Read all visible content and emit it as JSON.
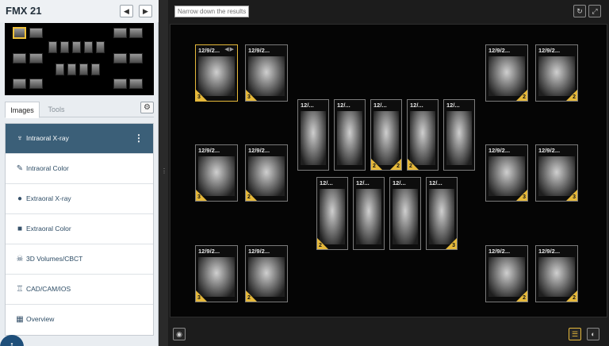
{
  "header": {
    "title": "FMX 21",
    "prev_icon": "triangle-left-icon",
    "next_icon": "triangle-right-icon"
  },
  "tabs": [
    {
      "label": "Images",
      "active": true
    },
    {
      "label": "Tools",
      "active": false
    }
  ],
  "menu": [
    {
      "label": "Intraoral X-ray",
      "icon": "tooth-icon",
      "active": true
    },
    {
      "label": "Intraoral Color",
      "icon": "tool-icon",
      "active": false
    },
    {
      "label": "Extraoral X-ray",
      "icon": "head-icon",
      "active": false
    },
    {
      "label": "Extraoral Color",
      "icon": "camera-icon",
      "active": false
    },
    {
      "label": "3D Volumes/CBCT",
      "icon": "skull-icon",
      "active": false
    },
    {
      "label": "CAD/CAM/IOS",
      "icon": "crown-icon",
      "active": false
    },
    {
      "label": "Overview",
      "icon": "grid-icon",
      "active": false
    }
  ],
  "filter": {
    "placeholder": "Narrow down the results"
  },
  "accent_color": "#e6b93b",
  "xrays": [
    {
      "date": "12/9/2...",
      "badge": "3",
      "badge_side": "left",
      "selected": true
    },
    {
      "date": "12/9/2...",
      "badge": "3",
      "badge_side": "left",
      "selected": false
    },
    {
      "date": "12/9/2...",
      "badge": "2",
      "badge_side": "right",
      "selected": false
    },
    {
      "date": "12/9/2...",
      "badge": "2",
      "badge_side": "right",
      "selected": false
    },
    {
      "date": "12/...",
      "badge": "",
      "badge_side": "",
      "selected": false
    },
    {
      "date": "12/...",
      "badge": "",
      "badge_side": "",
      "selected": false
    },
    {
      "date": "12/...",
      "badge": "2",
      "badge_side": "both3",
      "selected": false
    },
    {
      "date": "12/...",
      "badge": "2",
      "badge_side": "left",
      "selected": false
    },
    {
      "date": "12/...",
      "badge": "",
      "badge_side": "",
      "selected": false
    },
    {
      "date": "12/9/2...",
      "badge": "3",
      "badge_side": "left",
      "selected": false
    },
    {
      "date": "12/9/2...",
      "badge": "2",
      "badge_side": "left",
      "selected": false
    },
    {
      "date": "12/9/2...",
      "badge": "3",
      "badge_side": "right",
      "selected": false
    },
    {
      "date": "12/9/2...",
      "badge": "3",
      "badge_side": "right",
      "selected": false
    },
    {
      "date": "12/...",
      "badge": "2",
      "badge_side": "left",
      "selected": false
    },
    {
      "date": "12/...",
      "badge": "",
      "badge_side": "",
      "selected": false
    },
    {
      "date": "12/...",
      "badge": "",
      "badge_side": "",
      "selected": false
    },
    {
      "date": "12/...",
      "badge": "3",
      "badge_side": "right",
      "selected": false
    },
    {
      "date": "12/9/2...",
      "badge": "3",
      "badge_side": "left",
      "selected": false
    },
    {
      "date": "12/9/2...",
      "badge": "2",
      "badge_side": "left",
      "selected": false
    },
    {
      "date": "12/9/2...",
      "badge": "2",
      "badge_side": "right",
      "selected": false
    },
    {
      "date": "12/9/2...",
      "badge": "2",
      "badge_side": "right",
      "selected": false
    }
  ]
}
